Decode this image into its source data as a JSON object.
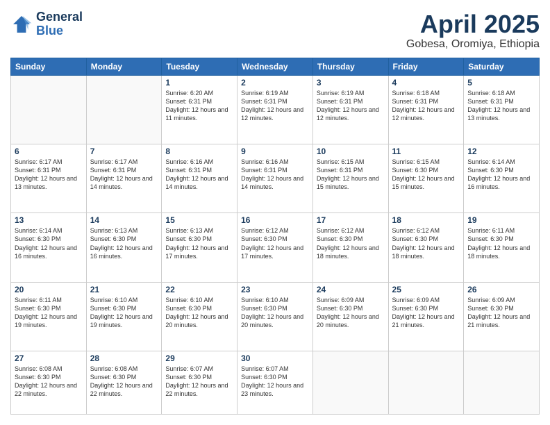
{
  "logo": {
    "line1": "General",
    "line2": "Blue"
  },
  "header": {
    "month": "April 2025",
    "location": "Gobesa, Oromiya, Ethiopia"
  },
  "weekdays": [
    "Sunday",
    "Monday",
    "Tuesday",
    "Wednesday",
    "Thursday",
    "Friday",
    "Saturday"
  ],
  "weeks": [
    [
      {
        "day": "",
        "info": ""
      },
      {
        "day": "",
        "info": ""
      },
      {
        "day": "1",
        "info": "Sunrise: 6:20 AM\nSunset: 6:31 PM\nDaylight: 12 hours\nand 11 minutes."
      },
      {
        "day": "2",
        "info": "Sunrise: 6:19 AM\nSunset: 6:31 PM\nDaylight: 12 hours\nand 12 minutes."
      },
      {
        "day": "3",
        "info": "Sunrise: 6:19 AM\nSunset: 6:31 PM\nDaylight: 12 hours\nand 12 minutes."
      },
      {
        "day": "4",
        "info": "Sunrise: 6:18 AM\nSunset: 6:31 PM\nDaylight: 12 hours\nand 12 minutes."
      },
      {
        "day": "5",
        "info": "Sunrise: 6:18 AM\nSunset: 6:31 PM\nDaylight: 12 hours\nand 13 minutes."
      }
    ],
    [
      {
        "day": "6",
        "info": "Sunrise: 6:17 AM\nSunset: 6:31 PM\nDaylight: 12 hours\nand 13 minutes."
      },
      {
        "day": "7",
        "info": "Sunrise: 6:17 AM\nSunset: 6:31 PM\nDaylight: 12 hours\nand 14 minutes."
      },
      {
        "day": "8",
        "info": "Sunrise: 6:16 AM\nSunset: 6:31 PM\nDaylight: 12 hours\nand 14 minutes."
      },
      {
        "day": "9",
        "info": "Sunrise: 6:16 AM\nSunset: 6:31 PM\nDaylight: 12 hours\nand 14 minutes."
      },
      {
        "day": "10",
        "info": "Sunrise: 6:15 AM\nSunset: 6:31 PM\nDaylight: 12 hours\nand 15 minutes."
      },
      {
        "day": "11",
        "info": "Sunrise: 6:15 AM\nSunset: 6:30 PM\nDaylight: 12 hours\nand 15 minutes."
      },
      {
        "day": "12",
        "info": "Sunrise: 6:14 AM\nSunset: 6:30 PM\nDaylight: 12 hours\nand 16 minutes."
      }
    ],
    [
      {
        "day": "13",
        "info": "Sunrise: 6:14 AM\nSunset: 6:30 PM\nDaylight: 12 hours\nand 16 minutes."
      },
      {
        "day": "14",
        "info": "Sunrise: 6:13 AM\nSunset: 6:30 PM\nDaylight: 12 hours\nand 16 minutes."
      },
      {
        "day": "15",
        "info": "Sunrise: 6:13 AM\nSunset: 6:30 PM\nDaylight: 12 hours\nand 17 minutes."
      },
      {
        "day": "16",
        "info": "Sunrise: 6:12 AM\nSunset: 6:30 PM\nDaylight: 12 hours\nand 17 minutes."
      },
      {
        "day": "17",
        "info": "Sunrise: 6:12 AM\nSunset: 6:30 PM\nDaylight: 12 hours\nand 18 minutes."
      },
      {
        "day": "18",
        "info": "Sunrise: 6:12 AM\nSunset: 6:30 PM\nDaylight: 12 hours\nand 18 minutes."
      },
      {
        "day": "19",
        "info": "Sunrise: 6:11 AM\nSunset: 6:30 PM\nDaylight: 12 hours\nand 18 minutes."
      }
    ],
    [
      {
        "day": "20",
        "info": "Sunrise: 6:11 AM\nSunset: 6:30 PM\nDaylight: 12 hours\nand 19 minutes."
      },
      {
        "day": "21",
        "info": "Sunrise: 6:10 AM\nSunset: 6:30 PM\nDaylight: 12 hours\nand 19 minutes."
      },
      {
        "day": "22",
        "info": "Sunrise: 6:10 AM\nSunset: 6:30 PM\nDaylight: 12 hours\nand 20 minutes."
      },
      {
        "day": "23",
        "info": "Sunrise: 6:10 AM\nSunset: 6:30 PM\nDaylight: 12 hours\nand 20 minutes."
      },
      {
        "day": "24",
        "info": "Sunrise: 6:09 AM\nSunset: 6:30 PM\nDaylight: 12 hours\nand 20 minutes."
      },
      {
        "day": "25",
        "info": "Sunrise: 6:09 AM\nSunset: 6:30 PM\nDaylight: 12 hours\nand 21 minutes."
      },
      {
        "day": "26",
        "info": "Sunrise: 6:09 AM\nSunset: 6:30 PM\nDaylight: 12 hours\nand 21 minutes."
      }
    ],
    [
      {
        "day": "27",
        "info": "Sunrise: 6:08 AM\nSunset: 6:30 PM\nDaylight: 12 hours\nand 22 minutes."
      },
      {
        "day": "28",
        "info": "Sunrise: 6:08 AM\nSunset: 6:30 PM\nDaylight: 12 hours\nand 22 minutes."
      },
      {
        "day": "29",
        "info": "Sunrise: 6:07 AM\nSunset: 6:30 PM\nDaylight: 12 hours\nand 22 minutes."
      },
      {
        "day": "30",
        "info": "Sunrise: 6:07 AM\nSunset: 6:30 PM\nDaylight: 12 hours\nand 23 minutes."
      },
      {
        "day": "",
        "info": ""
      },
      {
        "day": "",
        "info": ""
      },
      {
        "day": "",
        "info": ""
      }
    ]
  ]
}
